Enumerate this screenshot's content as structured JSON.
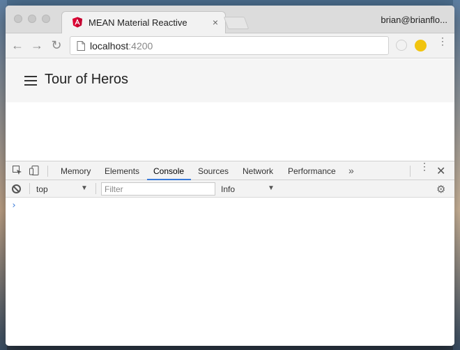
{
  "browser": {
    "tab": {
      "title": "MEAN Material Reactive",
      "close_label": "×"
    },
    "profile_name": "brian@brianflo...",
    "nav": {
      "back": "←",
      "forward": "→",
      "reload": "↻"
    },
    "address": {
      "host": "localhost",
      "port": ":4200"
    },
    "menu_icon": "⋮"
  },
  "app": {
    "title": "Tour of Heros"
  },
  "devtools": {
    "tabs": [
      {
        "label": "Memory"
      },
      {
        "label": "Elements"
      },
      {
        "label": "Console"
      },
      {
        "label": "Sources"
      },
      {
        "label": "Network"
      },
      {
        "label": "Performance"
      }
    ],
    "active_tab": "Console",
    "more_tabs": "»",
    "menu_icon": "⋮",
    "close_label": "✕",
    "console": {
      "context": "top",
      "filter_placeholder": "Filter",
      "level": "Info",
      "dropdown_arrow": "▼",
      "prompt": "›",
      "settings_icon": "⚙"
    }
  },
  "colors": {
    "accent": "#3879d9",
    "angular_red": "#dd0031"
  }
}
